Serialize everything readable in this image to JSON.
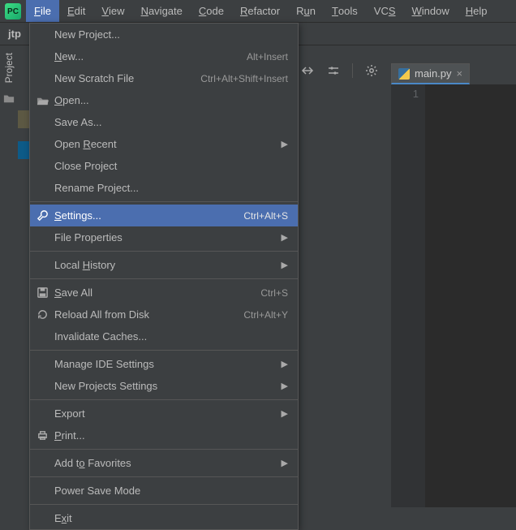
{
  "menubar": {
    "items": [
      {
        "label": "File",
        "mn": "F",
        "active": true
      },
      {
        "label": "Edit",
        "mn": "E"
      },
      {
        "label": "View",
        "mn": "V"
      },
      {
        "label": "Navigate",
        "mn": "N"
      },
      {
        "label": "Code",
        "mn": "C"
      },
      {
        "label": "Refactor",
        "mn": "R"
      },
      {
        "label": "Run",
        "mn": "u"
      },
      {
        "label": "Tools",
        "mn": "T"
      },
      {
        "label": "VCS",
        "mn": "S"
      },
      {
        "label": "Window",
        "mn": "W"
      },
      {
        "label": "Help",
        "mn": "H"
      }
    ]
  },
  "navbar": {
    "crumb": "jtp"
  },
  "left_panel": {
    "tab": "Project"
  },
  "file_menu": {
    "items": [
      {
        "label": "New Project..."
      },
      {
        "label": "New...",
        "mn": "N",
        "shortcut": "Alt+Insert"
      },
      {
        "label": "New Scratch File",
        "shortcut": "Ctrl+Alt+Shift+Insert"
      },
      {
        "label": "Open...",
        "mn": "O",
        "icon": "folder-open-icon"
      },
      {
        "label": "Save As..."
      },
      {
        "label": "Open Recent",
        "mn": "R",
        "submenu": true
      },
      {
        "label": "Close Project"
      },
      {
        "label": "Rename Project..."
      },
      {
        "sep": true
      },
      {
        "label": "Settings...",
        "mn": "S",
        "shortcut": "Ctrl+Alt+S",
        "icon": "wrench-icon",
        "selected": true
      },
      {
        "label": "File Properties",
        "submenu": true
      },
      {
        "sep": true
      },
      {
        "label": "Local History",
        "mn": "H",
        "submenu": true
      },
      {
        "sep": true
      },
      {
        "label": "Save All",
        "mn": "S",
        "shortcut": "Ctrl+S",
        "icon": "save-icon"
      },
      {
        "label": "Reload All from Disk",
        "shortcut": "Ctrl+Alt+Y",
        "icon": "reload-icon"
      },
      {
        "label": "Invalidate Caches..."
      },
      {
        "sep": true
      },
      {
        "label": "Manage IDE Settings",
        "submenu": true
      },
      {
        "label": "New Projects Settings",
        "submenu": true
      },
      {
        "sep": true
      },
      {
        "label": "Export",
        "submenu": true
      },
      {
        "label": "Print...",
        "mn": "P",
        "icon": "print-icon"
      },
      {
        "sep": true
      },
      {
        "label": "Add to Favorites",
        "mn": "o",
        "submenu": true
      },
      {
        "sep": true
      },
      {
        "label": "Power Save Mode"
      },
      {
        "sep": true
      },
      {
        "label": "Exit",
        "mn": "x"
      }
    ]
  },
  "toolbar": {
    "buttons": [
      {
        "name": "resize-icon"
      },
      {
        "name": "settings-sliders-icon"
      },
      {
        "name": "gear-icon"
      },
      {
        "name": "minimize-icon"
      }
    ]
  },
  "editor": {
    "tab_file": "main.py",
    "line_numbers": [
      "1"
    ]
  },
  "colors": {
    "accent": "#4b6eaf",
    "bg": "#3c3f41",
    "editor_bg": "#2b2b2b"
  }
}
